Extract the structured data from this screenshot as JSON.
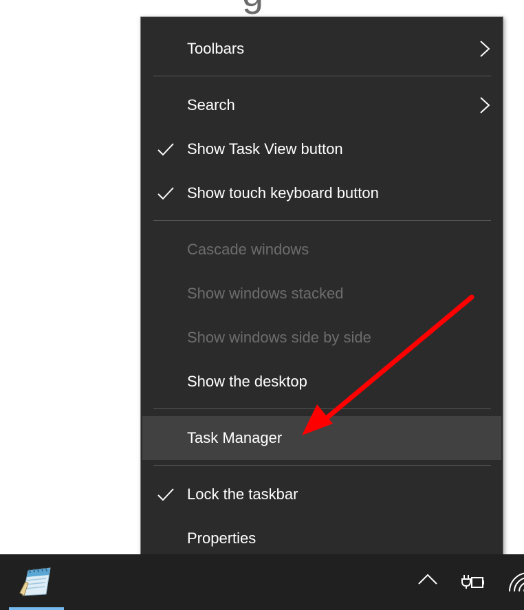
{
  "background": {
    "partial_glyph": "g"
  },
  "menu": {
    "items": [
      {
        "label": "Toolbars",
        "checked": false,
        "submenu": true,
        "disabled": false
      },
      {
        "label": "Search",
        "checked": false,
        "submenu": true,
        "disabled": false
      },
      {
        "label": "Show Task View button",
        "checked": true,
        "submenu": false,
        "disabled": false
      },
      {
        "label": "Show touch keyboard button",
        "checked": true,
        "submenu": false,
        "disabled": false
      },
      {
        "label": "Cascade windows",
        "checked": false,
        "submenu": false,
        "disabled": true
      },
      {
        "label": "Show windows stacked",
        "checked": false,
        "submenu": false,
        "disabled": true
      },
      {
        "label": "Show windows side by side",
        "checked": false,
        "submenu": false,
        "disabled": true
      },
      {
        "label": "Show the desktop",
        "checked": false,
        "submenu": false,
        "disabled": false
      },
      {
        "label": "Task Manager",
        "checked": false,
        "submenu": false,
        "disabled": false,
        "highlighted": true
      },
      {
        "label": "Lock the taskbar",
        "checked": true,
        "submenu": false,
        "disabled": false
      },
      {
        "label": "Properties",
        "checked": false,
        "submenu": false,
        "disabled": false
      }
    ]
  },
  "taskbar": {
    "pinned_app_icon": "notepad-icon",
    "tray_icons": [
      "chevron-up-icon",
      "power-plug-battery-icon",
      "wifi-icon"
    ]
  },
  "colors": {
    "menu_bg": "#2b2b2b",
    "menu_highlight": "#414141",
    "text": "#ffffff",
    "text_disabled": "#6d6d6d",
    "separator": "#5a5a5a",
    "taskbar_bg": "#202020",
    "active_indicator": "#76b9ed",
    "annotation_arrow": "#ff0000"
  }
}
